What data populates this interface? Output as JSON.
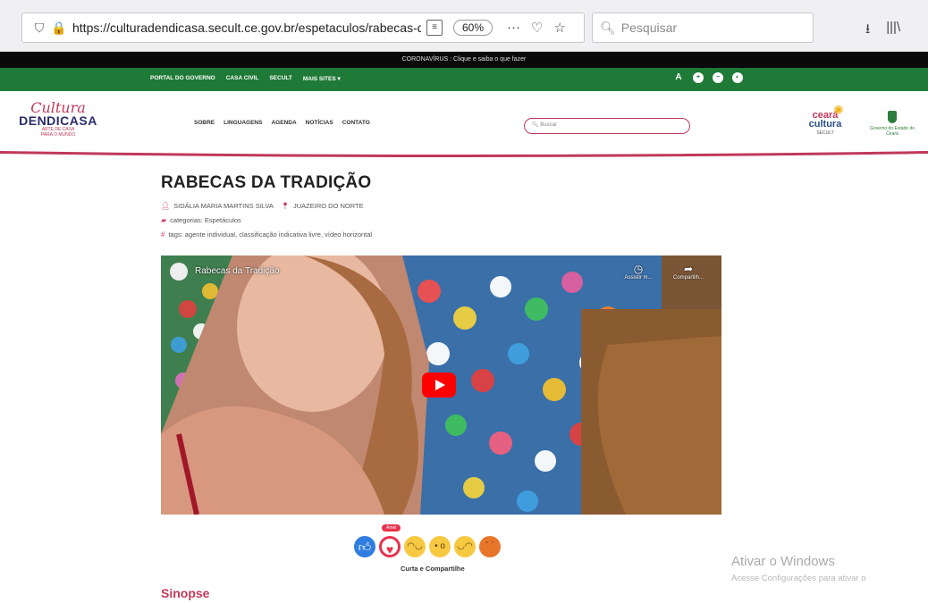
{
  "browser": {
    "url": "https://culturadendicasa.secult.ce.gov.br/espetaculos/rabecas-da-t",
    "zoom": "60%",
    "search_placeholder": "Pesquisar"
  },
  "covid": {
    "text": "CORONAVÍRUS : Clique e saiba o que fazer"
  },
  "top_links": [
    "PORTAL DO GOVERNO",
    "CASA CIVIL",
    "SECULT",
    "MAIS SITES ▾"
  ],
  "accessibility": {
    "font_label": "A"
  },
  "logo": {
    "script": "Cultura",
    "name": "DENDICASA",
    "sub1": "ARTE DE CASA",
    "sub2": "PARA O MUNDO"
  },
  "nav": [
    "SOBRE",
    "LINGUAGENS",
    "AGENDA",
    "NOTÍCIAS",
    "CONTATO"
  ],
  "site_search_placeholder": "Buscar",
  "partners": {
    "ceara1": "ceará",
    "ceara2": "cultura",
    "ceara3": "SECULT",
    "gov": "Governo do Estado do Ceará"
  },
  "post": {
    "title": "RABECAS DA TRADIÇÃO",
    "author": "SIDÁLIA MARIA MARTINS SILVA",
    "city": "JUAZEIRO DO NORTE",
    "categories": "categorias: Espetáculos",
    "tags": "tags: agente individual, classificação indicativa livre, vídeo horizontal"
  },
  "video": {
    "title": "Rabecas da Tradição",
    "watch_later": "Assistir m...",
    "share": "Compartilh..."
  },
  "reactions": {
    "badge": "Amei",
    "label": "Curta e Compartilhe"
  },
  "section_heading": "Sinopse",
  "windows": {
    "line1": "Ativar o Windows",
    "line2": "Acesse Configurações para ativar o"
  },
  "colors": {
    "green": "#1e7a36",
    "pink": "#c0395a",
    "navy": "#2b2b6b"
  }
}
